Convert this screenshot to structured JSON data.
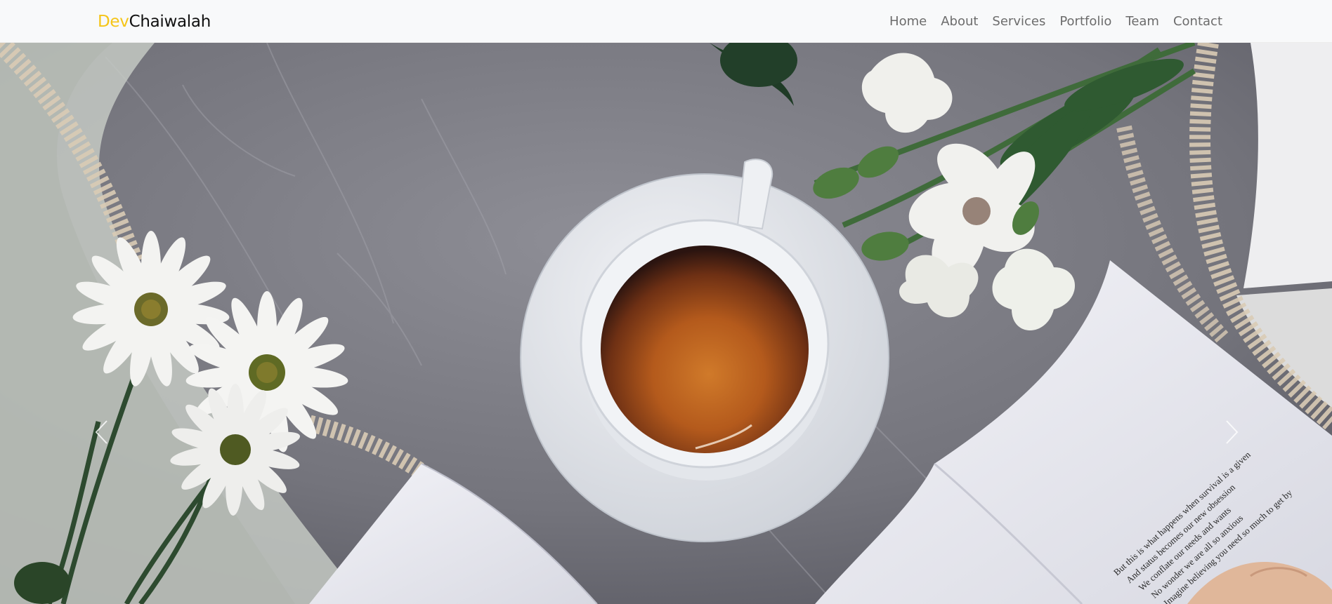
{
  "navbar": {
    "brand": {
      "prefix": "Dev",
      "suffix": "Chaiwalah",
      "accent_color": "#f5c518"
    },
    "links": [
      {
        "label": "Home"
      },
      {
        "label": "About"
      },
      {
        "label": "Services"
      },
      {
        "label": "Portfolio"
      },
      {
        "label": "Team"
      },
      {
        "label": "Contact"
      }
    ]
  },
  "hero": {
    "image_subject": "tea-cup-flowers-book-photo",
    "book_text_lines": [
      "But this is what happens when survival is a given",
      "And status becomes our new obsession",
      "We conflate our needs and wants",
      "No wonder we are all so anxious",
      "Imagine believing you need so much to get by"
    ],
    "prev_icon": "chevron-left-icon",
    "next_icon": "chevron-right-icon"
  }
}
